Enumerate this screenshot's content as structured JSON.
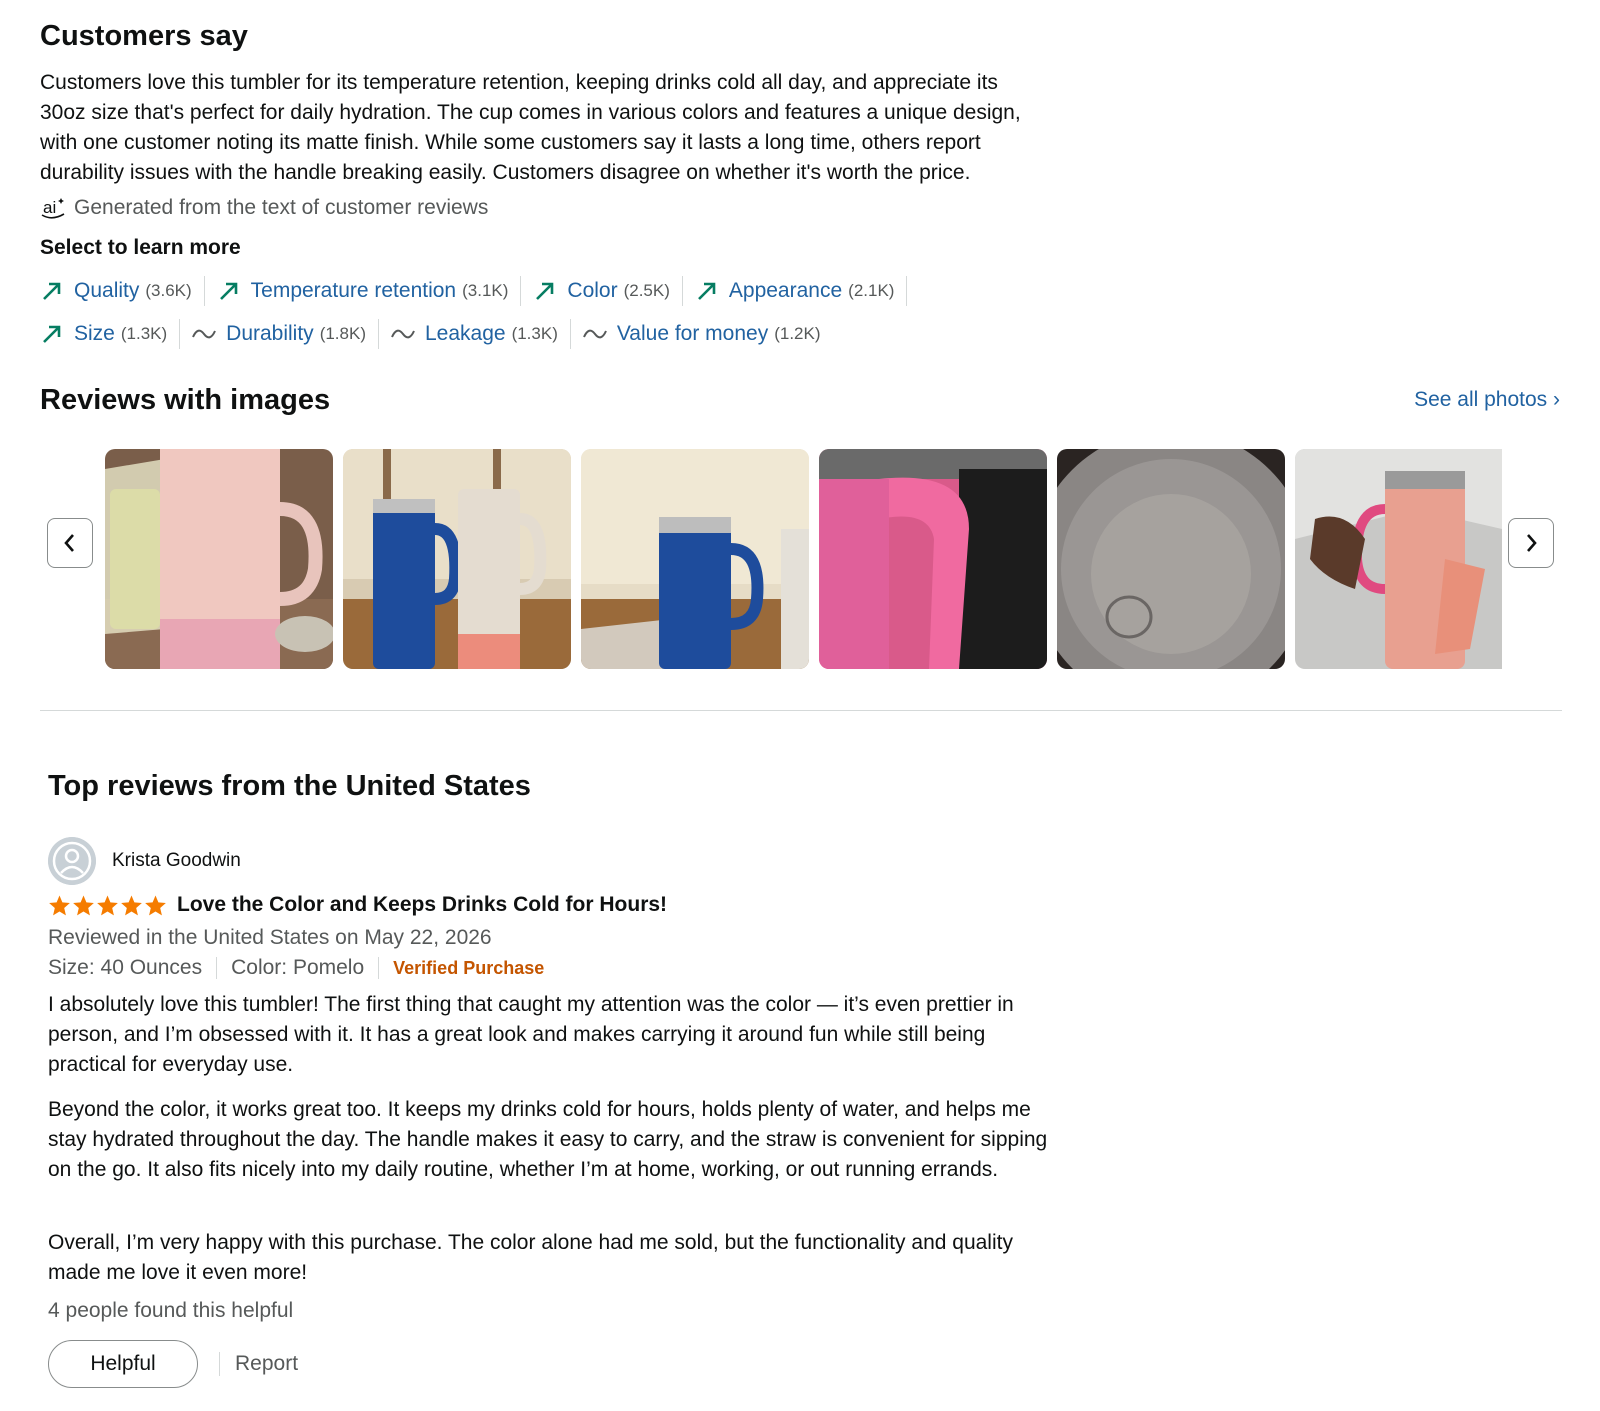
{
  "customers_say": {
    "title": "Customers say",
    "summary": "Customers love this tumbler for its temperature retention, keeping drinks cold all day, and appreciate its 30oz size that's perfect for daily hydration. The cup comes in various colors and features a unique design, with one customer noting its matte finish. While some customers say it lasts a long time, others report durability issues with the handle breaking easily. Customers disagree on whether it's worth the price.",
    "ai_icon": "ai-icon",
    "ai_note": "Generated from the text of customer reviews",
    "select_title": "Select to learn more",
    "aspects": [
      {
        "label": "Quality",
        "count": "(3.6K)",
        "trend": "positive-arrow-icon"
      },
      {
        "label": "Temperature retention",
        "count": "(3.1K)",
        "trend": "positive-arrow-icon"
      },
      {
        "label": "Color",
        "count": "(2.5K)",
        "trend": "positive-arrow-icon"
      },
      {
        "label": "Appearance",
        "count": "(2.1K)",
        "trend": "positive-arrow-icon"
      },
      {
        "label": "Size",
        "count": "(1.3K)",
        "trend": "positive-arrow-icon"
      },
      {
        "label": "Durability",
        "count": "(1.8K)",
        "trend": "mixed-wave-icon"
      },
      {
        "label": "Leakage",
        "count": "(1.3K)",
        "trend": "mixed-wave-icon"
      },
      {
        "label": "Value for money",
        "count": "(1.2K)",
        "trend": "mixed-wave-icon"
      }
    ],
    "colors": {
      "link": "#2162a1",
      "positive": "#067d62",
      "muted": "#565959"
    }
  },
  "reviews_with_images": {
    "title": "Reviews with images",
    "see_all": "See all photos ›",
    "prev_icon": "chevron-left-icon",
    "next_icon": "chevron-right-icon"
  },
  "top_reviews": {
    "title": "Top reviews from the United States",
    "review": {
      "reviewer": "Krista Goodwin",
      "rating": 5,
      "title": "Love the Color and Keeps Drinks Cold for Hours!",
      "date": "Reviewed in the United States on May 22, 2026",
      "size": "Size: 40 Ounces",
      "color": "Color: Pomelo",
      "verified": "Verified Purchase",
      "paragraphs": [
        "I absolutely love this tumbler! The first thing that caught my attention was the color — it’s even prettier in person, and I’m obsessed with it. It has a great look and makes carrying it around fun while still being practical for everyday use.",
        "Beyond the color, it works great too. It keeps my drinks cold for hours, holds plenty of water, and helps me stay hydrated throughout the day. The handle makes it easy to carry, and the straw is convenient for sipping on the go. It also fits nicely into my daily routine, whether I’m at home, working, or out running errands.",
        "Overall, I’m very happy with this purchase. The color alone had me sold, but the functionality and quality made me love it even more!"
      ],
      "helpful_count": "4 people found this helpful",
      "helpful_button": "Helpful",
      "report": "Report",
      "colors": {
        "star": "#f57c00",
        "verified": "#c45500"
      }
    }
  }
}
